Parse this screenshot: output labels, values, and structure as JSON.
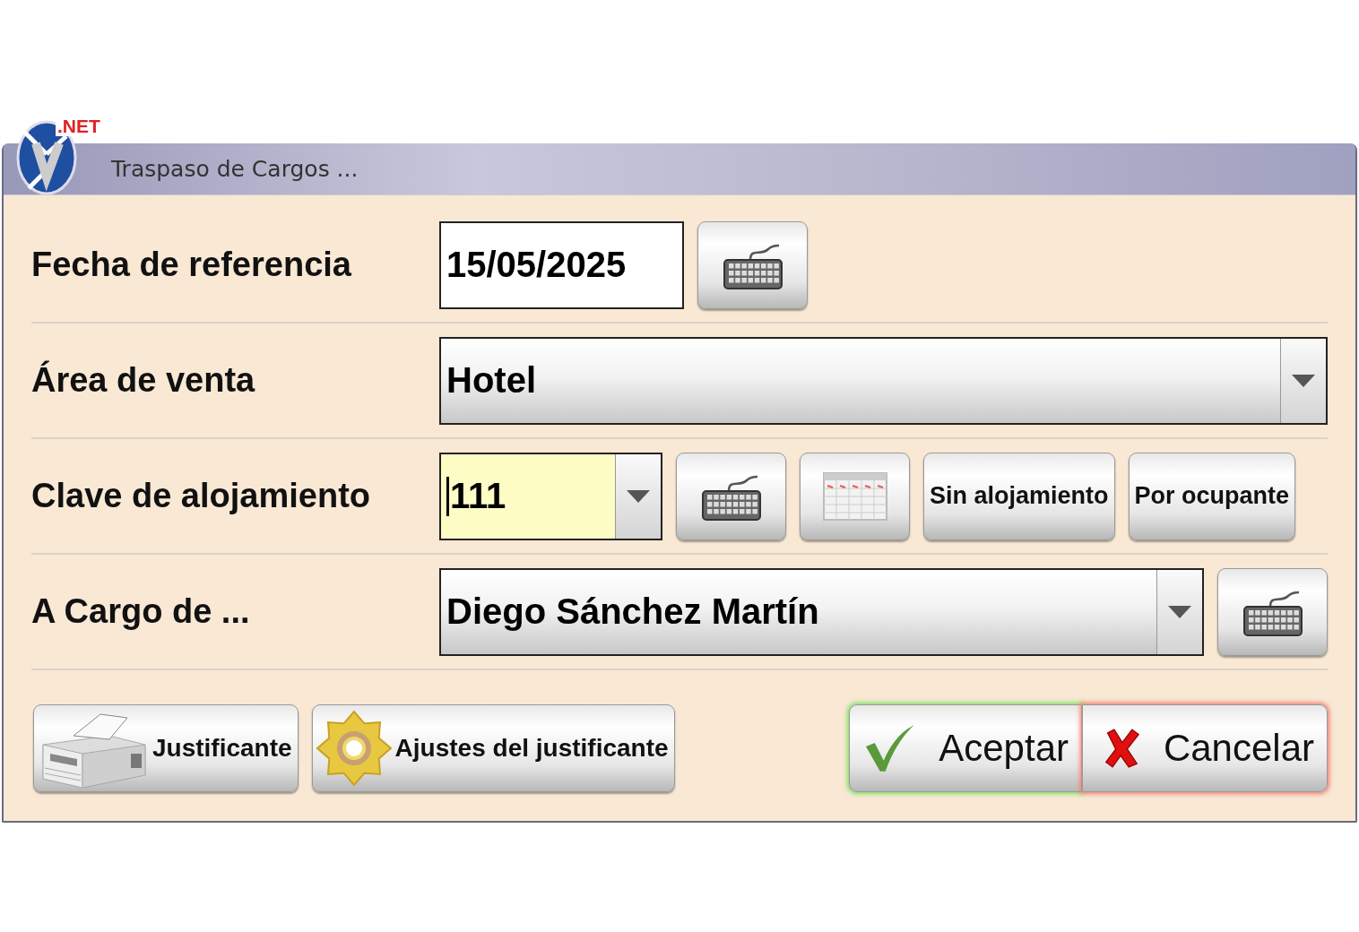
{
  "window": {
    "title": "Traspaso de Cargos ...",
    "logo_badge": ".NET"
  },
  "rows": [
    {
      "label": "Fecha de referencia",
      "input": {
        "kind": "text",
        "value": "15/05/2025",
        "focused": false
      },
      "tools": [
        {
          "kind": "keyboard"
        }
      ]
    },
    {
      "label": "Área de venta",
      "input": {
        "kind": "dropdown",
        "value": "Hotel",
        "focused": false
      },
      "tools": []
    },
    {
      "label": "Clave de alojamiento",
      "input": {
        "kind": "dropdown",
        "value": "111",
        "focused": true
      },
      "tools": [
        {
          "kind": "keyboard"
        },
        {
          "kind": "calendar"
        },
        {
          "kind": "text",
          "label": "Sin alojamiento"
        },
        {
          "kind": "text",
          "label": "Por ocupante"
        }
      ]
    },
    {
      "label": "A Cargo de ...",
      "input": {
        "kind": "dropdown",
        "value": "Diego Sánchez Martín",
        "focused": false
      },
      "tools": [
        {
          "kind": "keyboard"
        }
      ]
    }
  ],
  "footer_left": [
    {
      "kind": "printer",
      "label": "Justificante"
    },
    {
      "kind": "gear",
      "label": "Ajustes del justificante"
    }
  ],
  "footer_right": [
    {
      "kind": "accept",
      "label": "Aceptar"
    },
    {
      "kind": "cancel",
      "label": "Cancelar"
    }
  ]
}
